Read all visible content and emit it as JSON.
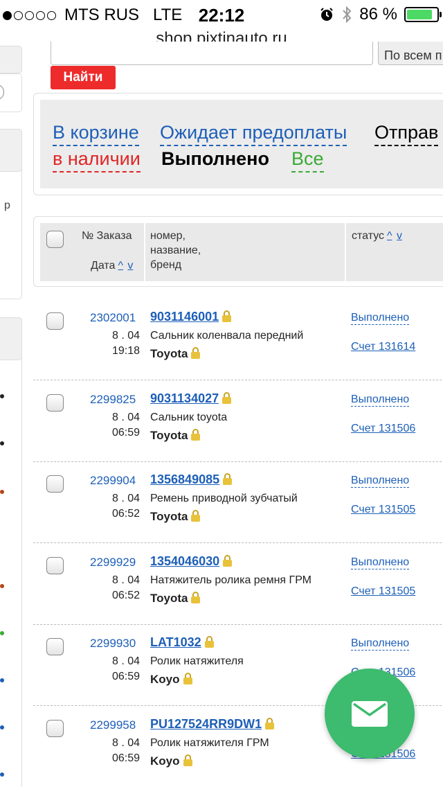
{
  "status_bar": {
    "carrier": "MTS RUS",
    "network": "LTE",
    "time": "22:12",
    "battery": "86 %",
    "battery_level": 0.86
  },
  "url": "shop.pixtinauto.ru",
  "search": {
    "select_label": "По всем п",
    "find_button": "Найти"
  },
  "left_fragments": [
    "р"
  ],
  "filters": {
    "in_cart": "В корзине",
    "awaiting_prepayment": "Ожидает предоплаты",
    "sent": "Отправ",
    "in_stock": "в наличии",
    "completed": "Выполнено",
    "all": "Все"
  },
  "table_header": {
    "order_no": "№ Заказа",
    "date": "Дата",
    "part_line1": "номер,",
    "part_line2": "название,",
    "part_line3": "бренд",
    "status": "статус",
    "sort_up": "^",
    "sort_down": "v"
  },
  "rows": [
    {
      "order": "2302001",
      "date": "8 . 04",
      "time": "19:18",
      "part_number": "9031146001",
      "name": "Сальник коленвала передний",
      "brand": "Toyota",
      "status": "Выполнено",
      "invoice": "Счет 131614"
    },
    {
      "order": "2299825",
      "date": "8 . 04",
      "time": "06:59",
      "part_number": "9031134027",
      "name": "Сальник toyota",
      "brand": "Toyota",
      "status": "Выполнено",
      "invoice": "Счет 131506"
    },
    {
      "order": "2299904",
      "date": "8 . 04",
      "time": "06:52",
      "part_number": "1356849085",
      "name": "Ремень приводной зубчатый",
      "brand": "Toyota",
      "status": "Выполнено",
      "invoice": "Счет 131505"
    },
    {
      "order": "2299929",
      "date": "8 . 04",
      "time": "06:52",
      "part_number": "1354046030",
      "name": "Натяжитель ролика ремня ГРМ",
      "brand": "Toyota",
      "status": "Выполнено",
      "invoice": "Счет 131505"
    },
    {
      "order": "2299930",
      "date": "8 . 04",
      "time": "06:59",
      "part_number": "LAT1032",
      "name": "Ролик натяжителя",
      "brand": "Koyo",
      "status": "Выполнено",
      "invoice": "Счет 131506"
    },
    {
      "order": "2299958",
      "date": "8 . 04",
      "time": "06:59",
      "part_number": "PU127524RR9DW1",
      "name": "Ролик натяжителя ГРМ",
      "brand": "Koyo",
      "status": "Выполнено",
      "invoice": "Счет 131506"
    }
  ],
  "colors": {
    "link_blue": "#1d5fb8",
    "find_red": "#ee2b2b",
    "in_stock_red": "#e12424",
    "all_green": "#3aaa35",
    "fab_green": "#3dbb6e",
    "lock_gold": "#e8c23a"
  },
  "icons": {
    "fab": "envelope-icon",
    "lock": "lock-icon"
  }
}
